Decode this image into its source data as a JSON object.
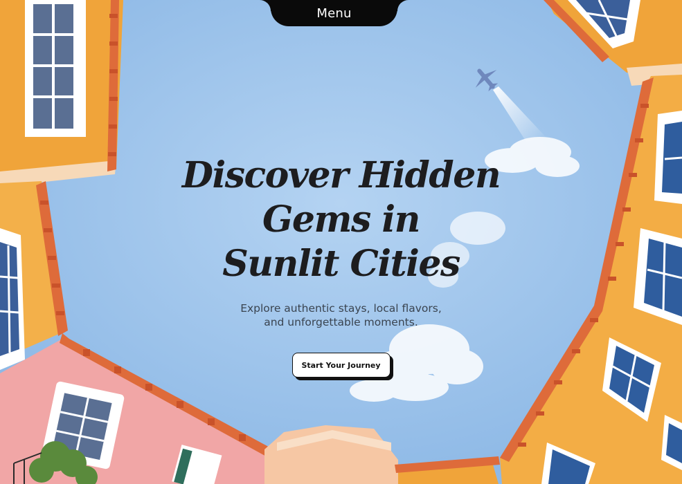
{
  "nav": {
    "menu_label": "Menu"
  },
  "hero": {
    "title_line1": "Discover Hidden Gems in",
    "title_line2": "Sunlit Cities",
    "subtitle_line1": "Explore authentic stays, local flavors,",
    "subtitle_line2": "and unforgettable moments.",
    "cta_label": "Start Your Journey"
  },
  "colors": {
    "sky": "#9cc3ea",
    "building_orange": "#f0a43a",
    "building_pink": "#f1a6a6",
    "roof_tile": "#de6b3a",
    "window_blue": "#2f5d9e",
    "text_dark": "#1d1d1f",
    "menu_bg": "#0a0a0a"
  },
  "icons": {
    "airplane": "airplane-icon"
  }
}
